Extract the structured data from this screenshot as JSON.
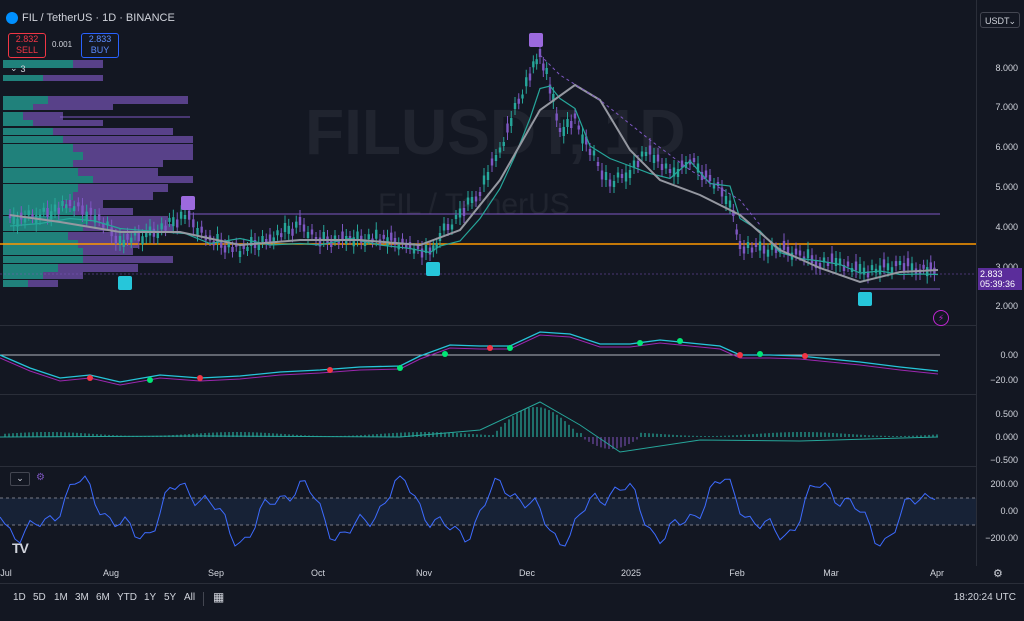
{
  "symbol": {
    "title": "FIL / TetherUS · 1D · BINANCE",
    "sell_price": "2.832",
    "sell_label": "SELL",
    "spread": "0.001",
    "buy_price": "2.833",
    "buy_label": "BUY",
    "indicators_count": "3"
  },
  "watermark": {
    "ticker": "FILUSDT, 1D",
    "name": "FIL / TetherUS"
  },
  "currency": "USDT",
  "price_axis": [
    "8.000",
    "7.000",
    "6.000",
    "5.000",
    "4.000",
    "3.000",
    "2.000"
  ],
  "last_price": {
    "value": "2.833",
    "countdown": "05:39:36"
  },
  "macd_axis": [
    "0.00",
    "−20.00"
  ],
  "osc_axis": [
    "0.500",
    "0.000",
    "−0.500"
  ],
  "cci_axis": [
    "200.00",
    "0.00",
    "−200.00"
  ],
  "time_axis": [
    "Jul",
    "Aug",
    "Sep",
    "Oct",
    "Nov",
    "Dec",
    "2025",
    "Feb",
    "Mar",
    "Apr"
  ],
  "timeframes": [
    "1D",
    "5D",
    "1M",
    "3M",
    "6M",
    "YTD",
    "1Y",
    "5Y",
    "All"
  ],
  "clock": "18:20:24 UTC",
  "colors": {
    "up": "#26a69a",
    "down": "#7e57c2",
    "orange_line": "#ff9800",
    "background": "#131722"
  }
}
